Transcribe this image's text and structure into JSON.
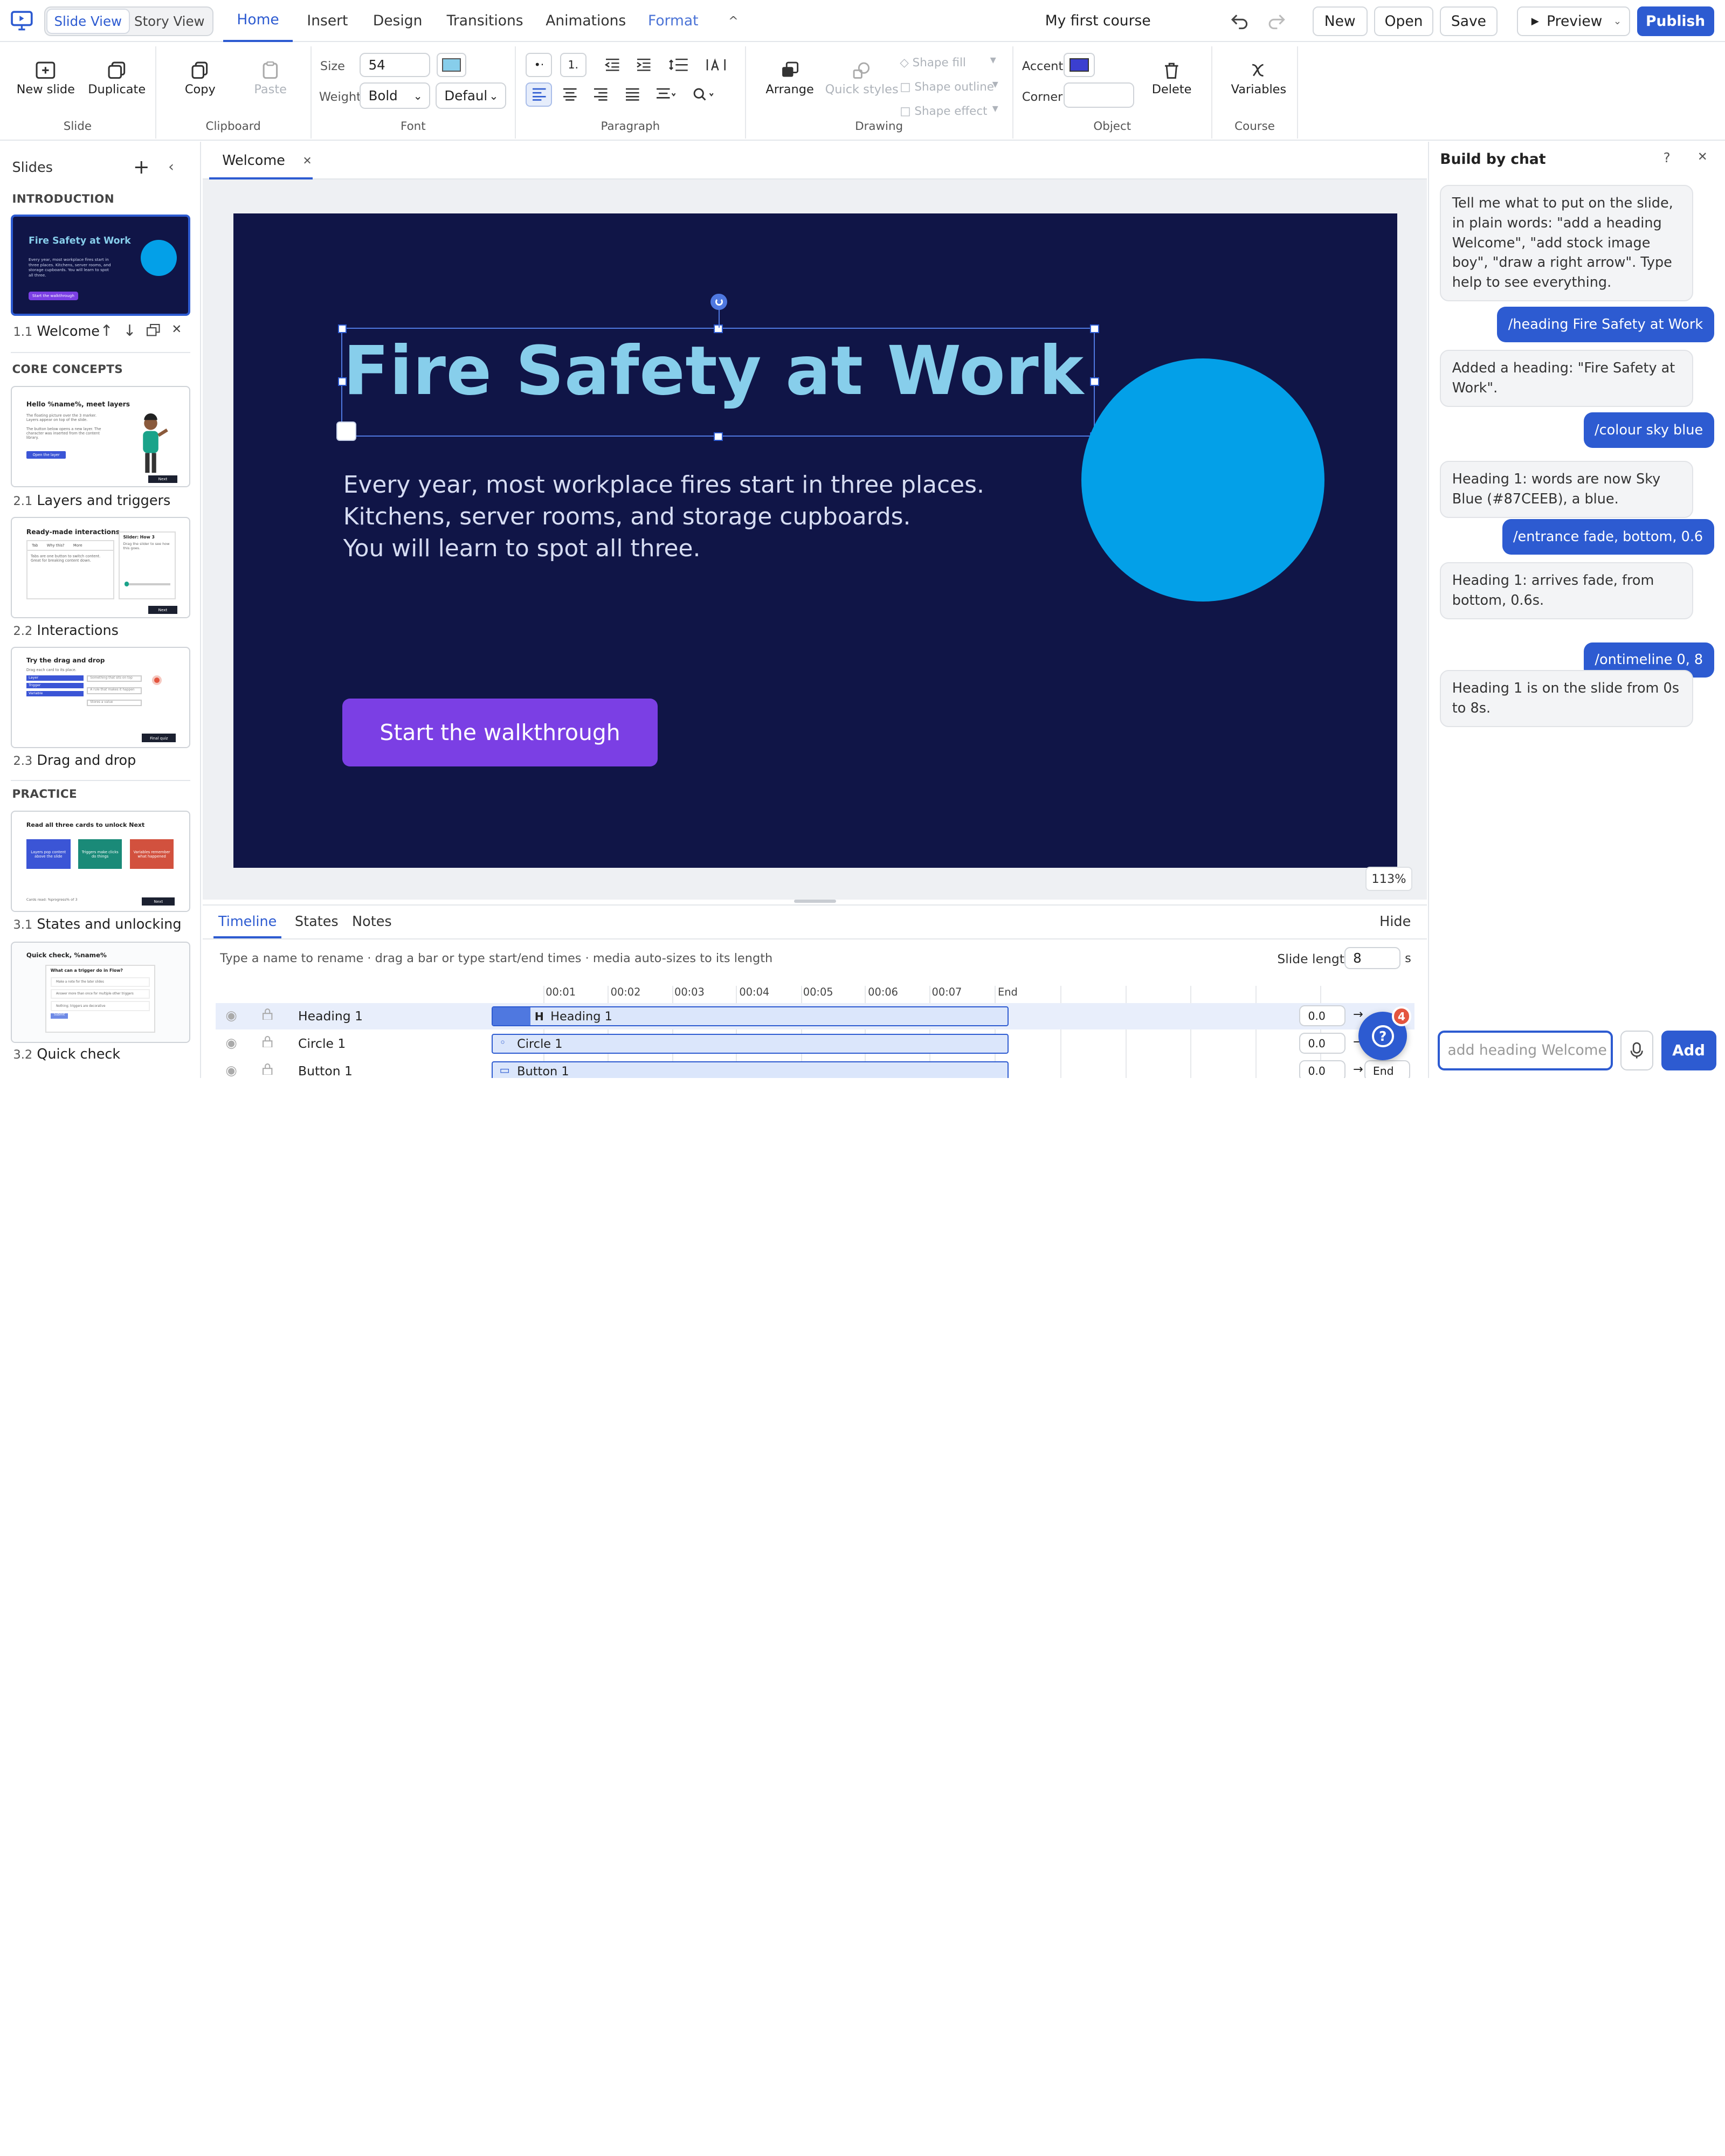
{
  "app": {
    "title": "My first course",
    "views": [
      "Slide View",
      "Story View"
    ],
    "tabs": [
      "Home",
      "Insert",
      "Design",
      "Transitions",
      "Animations",
      "Format"
    ],
    "buttons": {
      "new": "New",
      "open": "Open",
      "save": "Save",
      "preview": "Preview",
      "publish": "Publish"
    }
  },
  "ribbon": {
    "slide": {
      "new_slide": "New slide",
      "duplicate": "Duplicate",
      "label": "Slide"
    },
    "clipboard": {
      "copy": "Copy",
      "paste": "Paste",
      "label": "Clipboard"
    },
    "font": {
      "size_label": "Size",
      "size_value": "54",
      "weight_label": "Weight",
      "weight_value": "Bold",
      "family_value": "Defaul",
      "label": "Font",
      "color": "#87CEEB"
    },
    "paragraph": {
      "label": "Paragraph",
      "list_num": "1."
    },
    "drawing": {
      "arrange": "Arrange",
      "quick_styles": "Quick styles",
      "shape_fill": "Shape fill",
      "shape_outline": "Shape outline",
      "shape_effect": "Shape effect",
      "label": "Drawing"
    },
    "object": {
      "accent_label": "Accent",
      "accent_color": "#3B3FD0",
      "corner_label": "Corner",
      "delete": "Delete",
      "label": "Object"
    },
    "course": {
      "variables": "Variables",
      "label": "Course"
    }
  },
  "slides_panel": {
    "title": "Slides",
    "sections": [
      {
        "name": "INTRODUCTION",
        "items": [
          {
            "num": "1.1",
            "label": "Welcome"
          }
        ]
      },
      {
        "name": "CORE CONCEPTS",
        "items": [
          {
            "num": "2.1",
            "label": "Layers and triggers"
          },
          {
            "num": "2.2",
            "label": "Interactions"
          },
          {
            "num": "2.3",
            "label": "Drag and drop"
          }
        ]
      },
      {
        "name": "PRACTICE",
        "items": [
          {
            "num": "3.1",
            "label": "States and unlocking"
          },
          {
            "num": "3.2",
            "label": "Quick check"
          }
        ]
      }
    ],
    "thumbs": {
      "t1": {
        "title": "Fire Safety at Work",
        "body": "Every year, most workplace fires start in three places. Kitchens, server rooms, and storage cupboards. You will learn to spot all three.",
        "btn": "Start the walkthrough"
      },
      "t2": {
        "title": "Hello %name%, meet layers",
        "body": "The floating picture over the 3 marker. Layers appear on top of the slide.",
        "body2": "The button below opens a new layer. The character was inserted from the content library.",
        "btn": "Open the layer",
        "next": "Next"
      },
      "t3": {
        "title": "Ready-made interactions",
        "tabs": [
          "Tab",
          "Why this?",
          "More"
        ],
        "body": "Tabs are one button to switch content. Great for breaking content down.",
        "slider_title": "Slider: How 3",
        "slider_body": "Drag the slider to see how this goes.",
        "next": "Next"
      },
      "t4": {
        "title": "Try the drag and drop",
        "body": "Drag each card to its place.",
        "items": [
          "Layer",
          "Trigger",
          "Variable"
        ],
        "hints": [
          "Something that sits on top",
          "A rule that makes it happen",
          "Stores a value"
        ],
        "btn": "Final quiz"
      },
      "t5": {
        "title": "Read all three cards to unlock Next",
        "cards": [
          "Layers pop content above the slide",
          "Triggers make clicks do things",
          "Variables remember what happened"
        ],
        "foot": "Cards read: %progress% of 3",
        "next": "Next"
      },
      "t6": {
        "title": "Quick check, %name%",
        "q": "What can a trigger do in Flow?",
        "opts": [
          "Make a note for the later slides",
          "Answer more than once for multiple other triggers",
          "Nothing; triggers are decorative"
        ],
        "btn": "Submit"
      }
    }
  },
  "editor": {
    "tab": "Welcome",
    "zoom": "113%"
  },
  "slide": {
    "heading": "Fire Safety at Work",
    "body": [
      "Every year, most workplace fires start in three places.",
      "Kitchens, server rooms, and storage cupboards.",
      "You will learn to spot all three."
    ],
    "button": "Start the walkthrough",
    "bg": "#101547",
    "heading_color": "#87CEEB",
    "circle_color": "#03A0E8",
    "button_color": "#7B3FE4"
  },
  "timeline": {
    "tabs": [
      "Timeline",
      "States",
      "Notes"
    ],
    "hide": "Hide",
    "hint": "Type a name to rename · drag a bar or type start/end times · media auto-sizes to its length",
    "slide_length_label": "Slide length",
    "slide_length": "8",
    "unit": "s",
    "ticks": [
      "00:01",
      "00:02",
      "00:03",
      "00:04",
      "00:05",
      "00:06",
      "00:07",
      "End"
    ],
    "rows": [
      {
        "name": "Heading 1",
        "bar": "Heading 1",
        "start": "0.0",
        "end": "→"
      },
      {
        "name": "Circle 1",
        "bar": "Circle 1",
        "start": "0.0",
        "end": "→"
      },
      {
        "name": "Button 1",
        "bar": "Button 1",
        "start": "0.0",
        "end": "End"
      }
    ],
    "help_badge": "4"
  },
  "chat": {
    "title": "Build by chat",
    "messages": [
      {
        "from": "bot",
        "text": "Tell me what to put on the slide, in plain words: \"add a heading Welcome\", \"add stock image boy\", \"draw a right arrow\". Type help to see everything."
      },
      {
        "from": "user",
        "text": "/heading Fire Safety at Work"
      },
      {
        "from": "bot",
        "text": "Added a heading: \"Fire Safety at Work\"."
      },
      {
        "from": "user",
        "text": "/colour sky blue"
      },
      {
        "from": "bot",
        "text": "Heading 1: words are now Sky Blue (#87CEEB), a blue."
      },
      {
        "from": "user",
        "text": "/entrance fade, bottom, 0.6"
      },
      {
        "from": "bot",
        "text": "Heading 1: arrives fade, from bottom, 0.6s."
      },
      {
        "from": "user",
        "text": "/ontimeline 0, 8"
      },
      {
        "from": "bot",
        "text": "Heading 1 is on the slide from 0s to 8s."
      }
    ],
    "input_placeholder": "add heading Welcome to",
    "add": "Add"
  }
}
